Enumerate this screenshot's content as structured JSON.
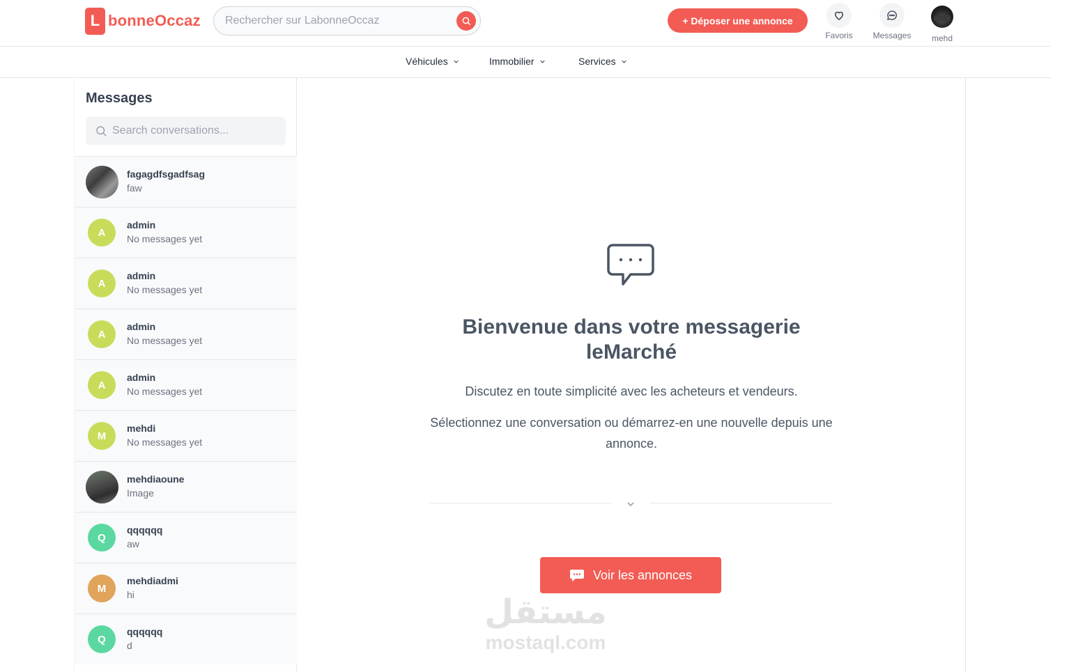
{
  "header": {
    "logo_letter": "L",
    "logo_text": "bonneOccaz",
    "search_placeholder": "Rechercher sur LabonneOccaz",
    "post_button": "+ Déposer une annonce",
    "favorites_label": "Favoris",
    "messages_label": "Messages",
    "user_label": "mehd",
    "brand_color": "#f25c54"
  },
  "nav": {
    "items": [
      {
        "label": "Véhicules"
      },
      {
        "label": "Immobilier"
      },
      {
        "label": "Services"
      }
    ]
  },
  "sidebar": {
    "title": "Messages",
    "search_placeholder": "Search conversations...",
    "conversations": [
      {
        "name": "fagagdfsgadfsag",
        "preview": "faw",
        "avatar": "photo"
      },
      {
        "name": "admin",
        "preview": "No messages yet",
        "avatar": "A",
        "color": "#c8dc5a"
      },
      {
        "name": "admin",
        "preview": "No messages yet",
        "avatar": "A",
        "color": "#c8dc5a"
      },
      {
        "name": "admin",
        "preview": "No messages yet",
        "avatar": "A",
        "color": "#c8dc5a"
      },
      {
        "name": "admin",
        "preview": "No messages yet",
        "avatar": "A",
        "color": "#c8dc5a"
      },
      {
        "name": "mehdi",
        "preview": "No messages yet",
        "avatar": "M",
        "color": "#c8dc5a"
      },
      {
        "name": "mehdiaoune",
        "preview": "Image",
        "avatar": "photo"
      },
      {
        "name": "qqqqqq",
        "preview": "aw",
        "avatar": "Q",
        "color": "#5ad8a0"
      },
      {
        "name": "mehdiadmi",
        "preview": "hi",
        "avatar": "M",
        "color": "#e0a45a"
      },
      {
        "name": "qqqqqq",
        "preview": "d",
        "avatar": "Q",
        "color": "#5ad8a0"
      }
    ]
  },
  "main": {
    "welcome_title": "Bienvenue dans votre messagerie leMarché",
    "subtitle1": "Discutez en toute simplicité avec les acheteurs et vendeurs.",
    "subtitle2": "Sélectionnez une conversation ou démarrez-en une nouvelle depuis une annonce.",
    "cta_label": "Voir les annonces",
    "watermark_ar": "مستقل",
    "watermark_en": "mostaql.com"
  }
}
